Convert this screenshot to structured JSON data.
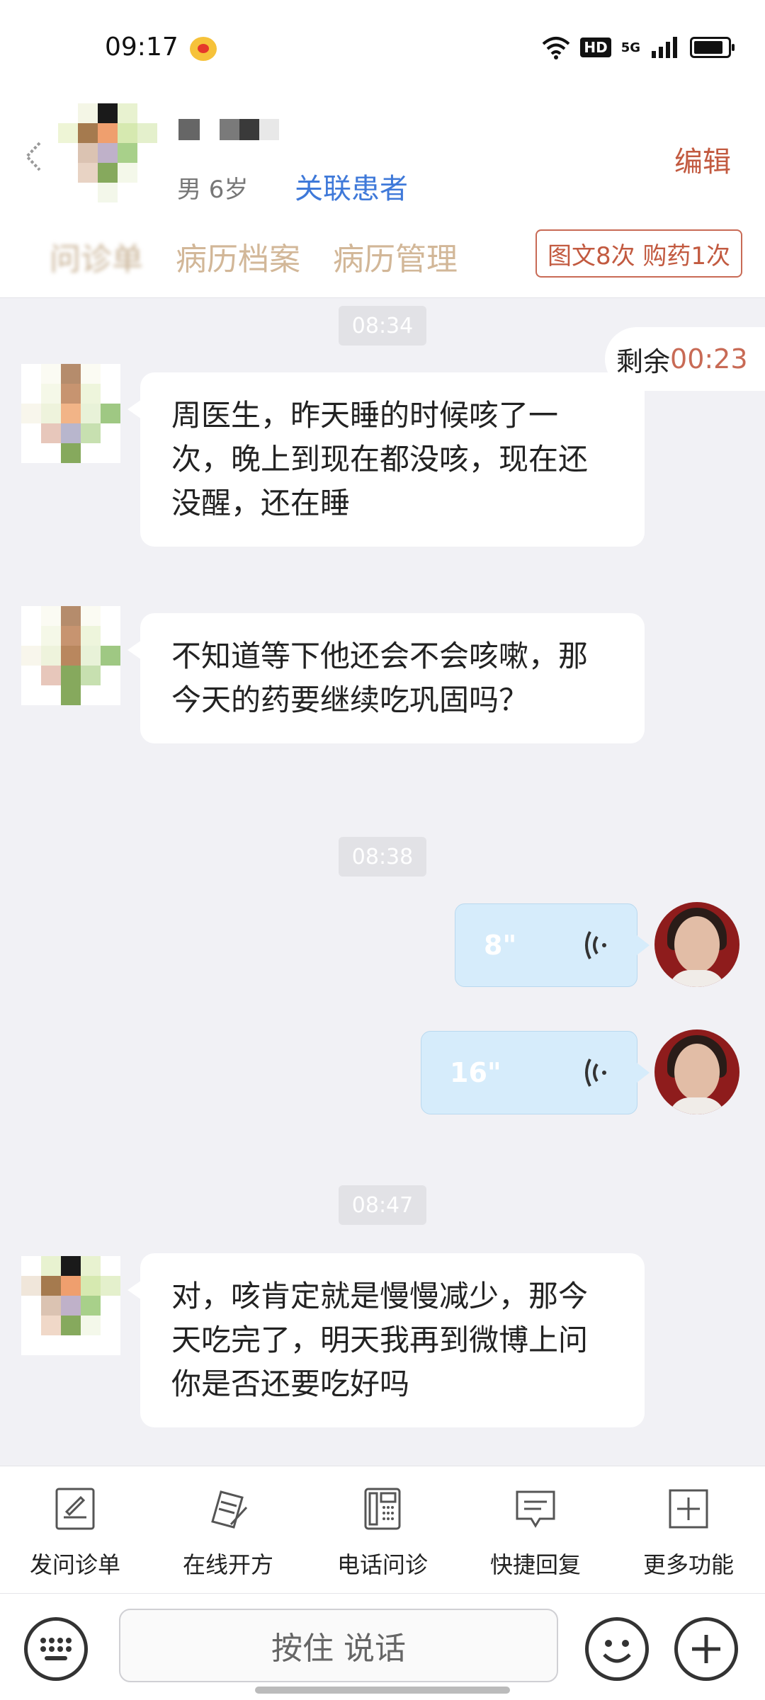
{
  "status_bar": {
    "time": "09:17",
    "hd": "HD",
    "network": "5G",
    "icons": [
      "weibo-icon",
      "wifi-icon",
      "signal-icon",
      "battery-icon"
    ]
  },
  "header": {
    "gender_age": "男 6岁",
    "link_patient": "关联患者",
    "edit": "编辑",
    "tabs": [
      "问诊单",
      "病历档案",
      "病历管理"
    ],
    "badge": "图文8次 购药1次"
  },
  "chat": {
    "remaining_label": "剩余",
    "remaining_value": "00:23",
    "timestamps": [
      "08:34",
      "08:38",
      "08:47"
    ],
    "messages": [
      {
        "text": "周医生，昨天睡的时候咳了一次，晚上到现在都没咳，现在还没醒，还在睡"
      },
      {
        "text": "不知道等下他还会不会咳嗽，那今天的药要继续吃巩固吗？"
      },
      {
        "text": "对，咳肯定就是慢慢减少，那今天吃完了，明天我再到微博上问你是否还要吃好吗"
      }
    ],
    "voices": [
      {
        "duration": "8\""
      },
      {
        "duration": "16\""
      }
    ]
  },
  "toolbar": {
    "items": [
      {
        "label": "发问诊单",
        "icon": "form-icon"
      },
      {
        "label": "在线开方",
        "icon": "prescription-icon"
      },
      {
        "label": "电话问诊",
        "icon": "phone-icon"
      },
      {
        "label": "快捷回复",
        "icon": "quick-reply-icon"
      },
      {
        "label": "更多功能",
        "icon": "more-icon"
      }
    ]
  },
  "input_bar": {
    "hold_to_talk": "按住 说话"
  },
  "colors": {
    "accent_red": "#c25a40",
    "link_blue": "#3f79d9",
    "voice_blue": "#d6ecfb",
    "tab_gold": "#d2b798"
  }
}
